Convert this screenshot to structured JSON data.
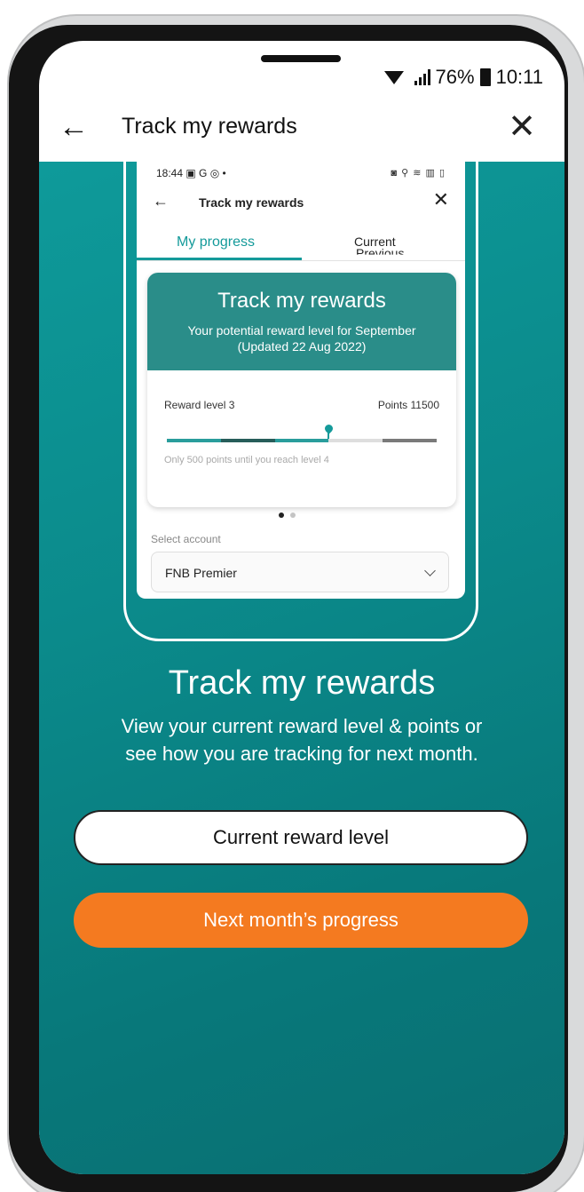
{
  "status_bar": {
    "battery": "76%",
    "time": "10:11"
  },
  "header": {
    "title": "Track my rewards"
  },
  "preview": {
    "status_time": "18:44",
    "status_glyphs": "▣ G ◎ •",
    "status_right_glyphs": "◙ ⚲ ≋ ▥ ▯",
    "title": "Track my rewards",
    "tabs": {
      "progress": "My progress",
      "current": "Current",
      "previous": "Previous"
    },
    "card": {
      "title": "Track my rewards",
      "subtitle": "Your potential reward level for September",
      "updated": "(Updated 22 Aug 2022)",
      "level": "Reward level 3",
      "points": "Points 11500",
      "note": "Only 500 points until you reach level 4",
      "progress_fraction": 0.6,
      "colors": {
        "teal": "#2a9d9c",
        "dark": "#275d5a",
        "light": "#dedede",
        "grey": "#7a7a7a"
      }
    },
    "select": {
      "label": "Select account",
      "value": "FNB Premier"
    }
  },
  "main": {
    "title": "Track my rewards",
    "description_line1": "View your current reward level & points or",
    "description_line2": "see how you are tracking for next month."
  },
  "buttons": {
    "current": "Current reward level",
    "next": "Next month’s progress"
  },
  "colors": {
    "teal": "#0b8a8b",
    "orange": "#f47a20"
  }
}
